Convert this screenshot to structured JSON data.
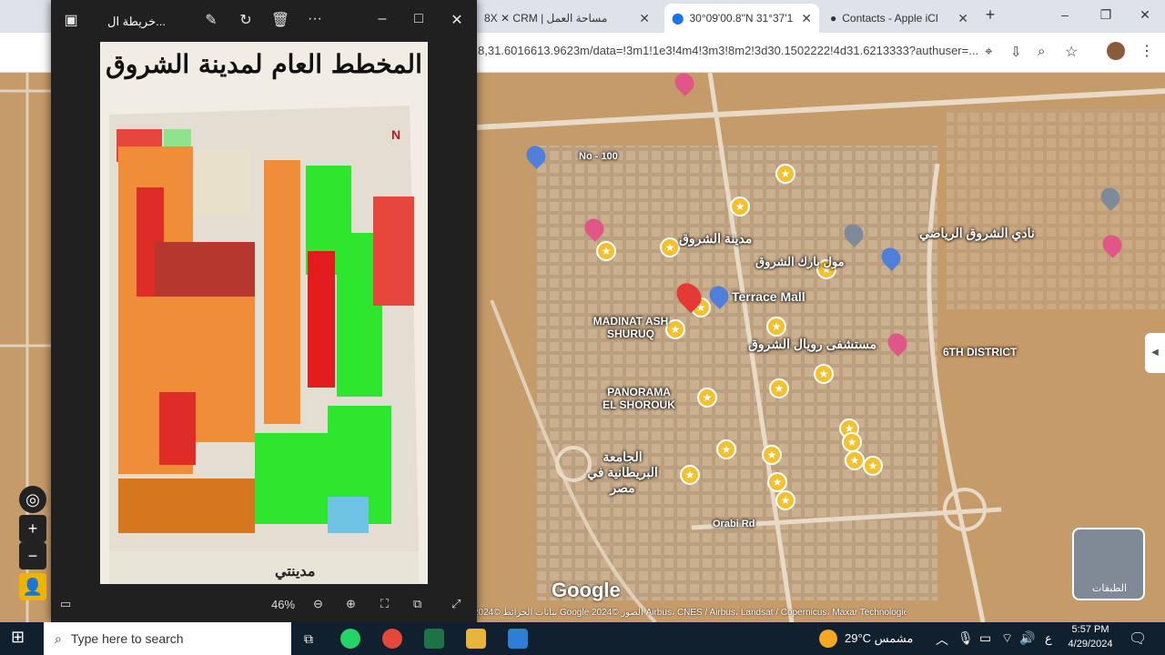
{
  "browser": {
    "tabs": [
      {
        "label": "8X ✕ CRM | مساحة العمل",
        "close": "✕"
      },
      {
        "label": "30°09'00.8\"N 31°37'1",
        "close": "✕"
      },
      {
        "label": "Contacts - Apple iCl",
        "close": "✕"
      }
    ],
    "new_tab": "+",
    "url": "8,31.6016613.9623m/data=!3m1!1e3!4m4!3m3!8m2!3d30.1502222!4d31.6213333?authuser=...",
    "controls": {
      "minimize": "–",
      "restore": "❐",
      "close": "✕"
    }
  },
  "viewer": {
    "title": "خريطة ال...",
    "zoom": "46%",
    "map_heading": "المخطط العام لمدينة الشروق",
    "map_brand": "مدينتي",
    "north": "N",
    "controls": {
      "minimize": "–",
      "maximize": "□",
      "close": "✕",
      "more": "···"
    }
  },
  "map": {
    "labels": [
      "Terrace Mall",
      "MADINAT ASH SHURUQ",
      "PANORAMA EL SHOROUK",
      "6TH DISTRICT",
      "مستشفى رويال الشروق",
      "مدينة الشروق",
      "مول بارك الشروق",
      "نادي الشروق الرياضي",
      "الجامعة البريطانية في مصر",
      "Orabi Rd",
      "No - 100"
    ],
    "google": "Google",
    "attribution": "بيانات الخرائط ©2024 Google الصور ©2024 Airbus، CNES / Airbus، Landsat / Copernicus، Maxar Technologies",
    "layers_label": "الطبقات"
  },
  "taskbar": {
    "search_placeholder": "Type here to search",
    "weather": "29°C مشمس",
    "time": "5:57 PM",
    "date": "4/29/2024",
    "lang": "ع"
  }
}
